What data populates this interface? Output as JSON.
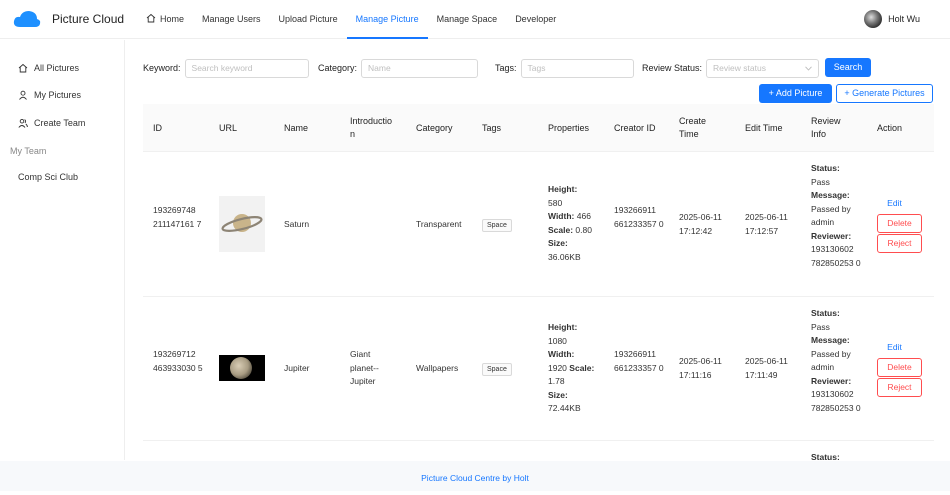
{
  "header": {
    "brand": "Picture Cloud",
    "nav": [
      "Home",
      "Manage Users",
      "Upload Picture",
      "Manage Picture",
      "Manage Space",
      "Developer"
    ],
    "active_nav": "Manage Picture",
    "user_name": "Holt Wu"
  },
  "sidebar": {
    "items": [
      "All Pictures",
      "My Pictures",
      "Create Team"
    ],
    "group_label": "My Team",
    "team": "Comp Sci Club"
  },
  "filters": {
    "keyword_label": "Keyword:",
    "keyword_placeholder": "Search keyword",
    "category_label": "Category:",
    "category_placeholder": "Name",
    "tags_label": "Tags:",
    "tags_placeholder": "Tags",
    "review_label": "Review Status:",
    "review_placeholder": "Review status",
    "search_button": "Search"
  },
  "buttons": {
    "add": "+ Add Picture",
    "generate": "+ Generate Pictures"
  },
  "table": {
    "columns": [
      "ID",
      "URL",
      "Name",
      "Introductio n",
      "Category",
      "Tags",
      "Properties",
      "Creator ID",
      "Create Time",
      "Edit Time",
      "Review Info",
      "Action"
    ],
    "rows": [
      {
        "id": "193269748 211147161 7",
        "name": "Saturn",
        "intro": "",
        "category": "Transparent",
        "tag": "Space",
        "height": "580",
        "width": "466",
        "scale": "0.80",
        "size": "36.06KB",
        "creator": "193266911 661233357 0",
        "create_time": "2025-06-11 17:12:42",
        "edit_time": "2025-06-11 17:12:57",
        "status": "Pass",
        "message": "Passed by admin",
        "reviewer": "193130602 782850253 0"
      },
      {
        "id": "193269712 463933030 5",
        "name": "Jupiter",
        "intro": "Giant planet-- Jupiter",
        "category": "Wallpapers",
        "tag": "Space",
        "height": "1080",
        "width": "1920",
        "scale": "1.78",
        "size": "72.44KB",
        "creator": "193266911 661233357 0",
        "create_time": "2025-06-11 17:11:16",
        "edit_time": "2025-06-11 17:11:49",
        "status": "Pass",
        "message": "Passed by admin",
        "reviewer": "193130602 782850253 0"
      }
    ],
    "labels": {
      "height": "Height:",
      "width": "Width:",
      "scale": "Scale:",
      "size": "Size:",
      "status": "Status:",
      "message": "Message:",
      "reviewer": "Reviewer:"
    },
    "actions": {
      "edit": "Edit",
      "delete": "Delete",
      "reject": "Reject"
    },
    "partial_row_status": "Status:"
  },
  "footer": "Picture Cloud Centre by Holt"
}
